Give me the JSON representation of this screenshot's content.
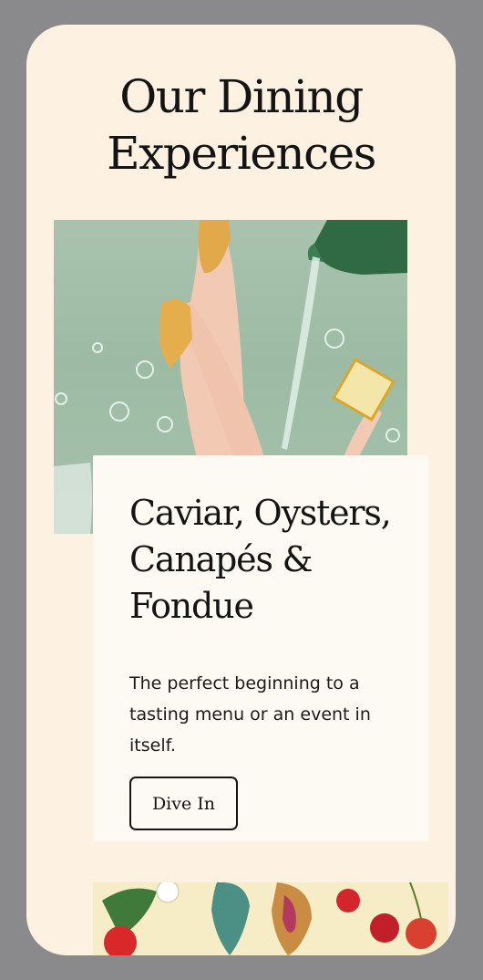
{
  "page": {
    "title": "Our Dining Experiences"
  },
  "hero_image": {
    "description_icon": "illustration-legs-bubbles-bottle"
  },
  "card": {
    "title": "Caviar, Oysters, Canapés & Fondue",
    "text": "The perfect beginning to a tasting menu or an event in itself.",
    "button_label": "Dive In"
  },
  "bottom_image": {
    "icon": "botanical-fruit-illustration"
  },
  "colors": {
    "background": "#fdf2e1",
    "card": "#fdfaf4",
    "device_frame": "#8a8a8c",
    "text": "#141414"
  }
}
